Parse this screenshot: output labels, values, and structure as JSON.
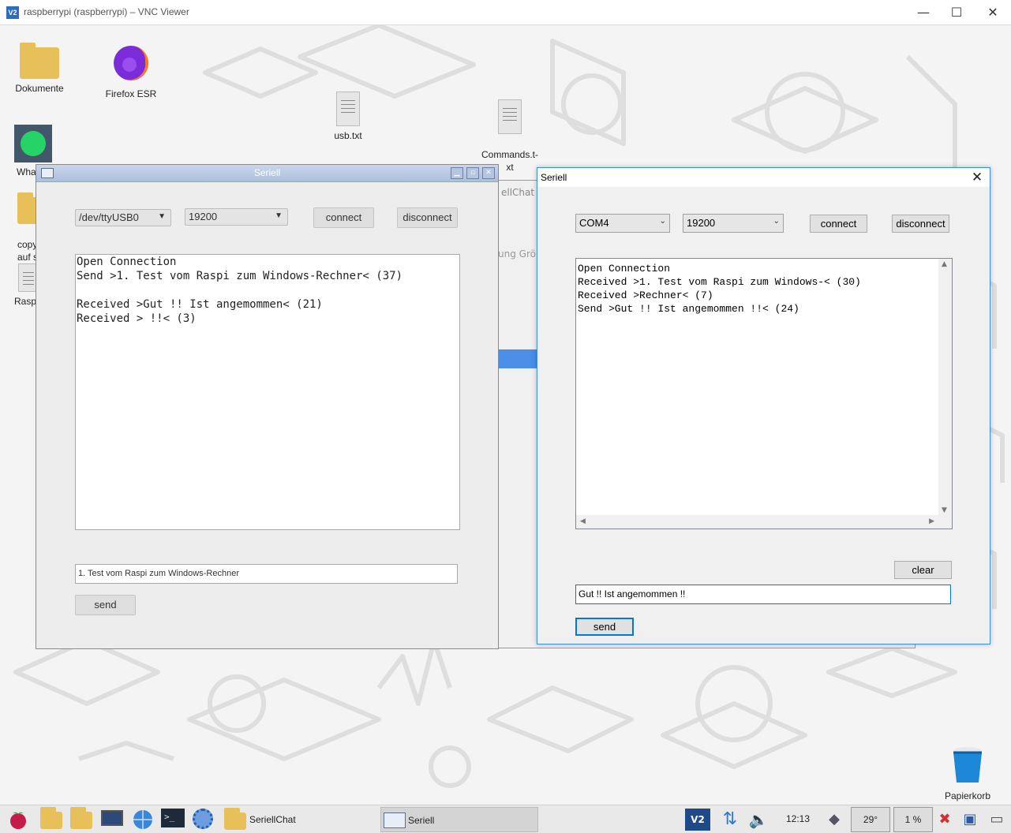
{
  "vnc": {
    "title": "raspberrypi (raspberrypi) – VNC Viewer",
    "logo_text": "V2",
    "controls": {
      "minimize": "—",
      "maximize": "☐",
      "close": "✕"
    }
  },
  "desktop": {
    "icons": {
      "dokumente": "Dokumente",
      "firefox": "Firefox ESR",
      "usb": "usb.txt",
      "commands": "Commands.t-\nxt",
      "whatsapp": "Wha",
      "copy": "copy\nauf s",
      "rasp": "Rasp",
      "papierkorb": "Papierkorb"
    },
    "back_window_tab": "ellChat",
    "back_window_cols": "ung   Grö"
  },
  "left_window": {
    "title": "Seriell",
    "port_value": "/dev/ttyUSB0",
    "baud_value": "19200",
    "connect_label": "connect",
    "disconnect_label": "disconnect",
    "log": "Open Connection\nSend >1. Test vom Raspi zum Windows-Rechner< (37)\n\nReceived >Gut !! Ist angemommen< (21)\nReceived > !!< (3)",
    "input_value": "1. Test vom Raspi zum Windows-Rechner",
    "send_label": "send"
  },
  "right_window": {
    "title": "Seriell",
    "port_value": "COM4",
    "baud_value": "19200",
    "connect_label": "connect",
    "disconnect_label": "disconnect",
    "log": "Open Connection\nReceived >1. Test vom Raspi zum Windows-< (30)\nReceived >Rechner< (7)\nSend >Gut !! Ist angemommen !!< (24)",
    "clear_label": "clear",
    "input_value": "Gut !! Ist angemommen !!",
    "send_label": "send"
  },
  "taskbar": {
    "seriellchat": "SeriellChat",
    "seriell": "Seriell",
    "clock": "12:13",
    "temp": "29°",
    "cpu": "1 %"
  },
  "colors": {
    "windows_accent": "#0078d7",
    "raspi_title": "#aebfdc"
  }
}
